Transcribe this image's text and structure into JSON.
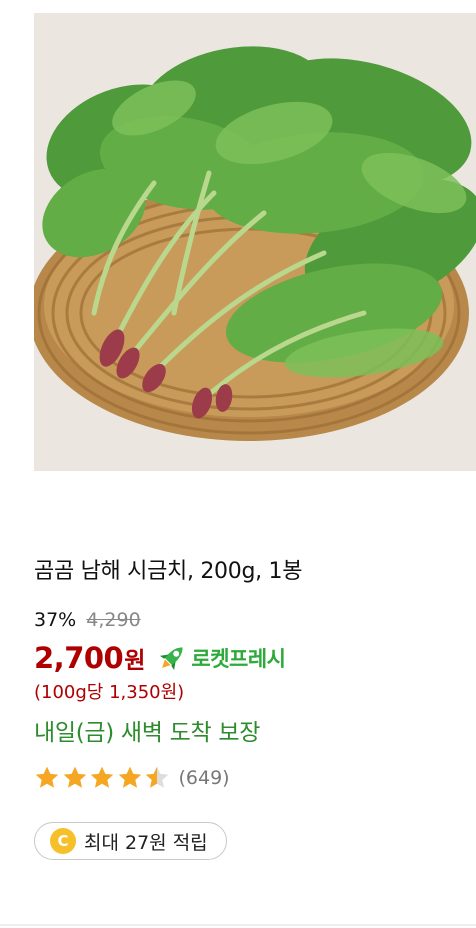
{
  "product": {
    "image_icon": "spinach-photo",
    "title": "곰곰 남해 시금치, 200g, 1봉",
    "discount_rate": "37%",
    "original_price": "4,290",
    "sale_price": "2,700",
    "currency_unit": "원",
    "delivery_badge": {
      "icon": "rocket-icon",
      "label": "로켓프레시",
      "color": "#2eaa3a"
    },
    "unit_price": "(100g당 1,350원)",
    "delivery_promise": "내일(금) 새벽 도착 보장",
    "rating": {
      "stars": 4.5,
      "out_of": 5,
      "review_count": "(649)",
      "star_color": "#f5a623"
    },
    "cashback": {
      "icon": "coin-icon",
      "coin_letter": "C",
      "label": "최대 27원 적립"
    }
  },
  "colors": {
    "price": "#ae0000",
    "delivery_text": "#2e8b2e",
    "coin": "#f6c02a"
  }
}
